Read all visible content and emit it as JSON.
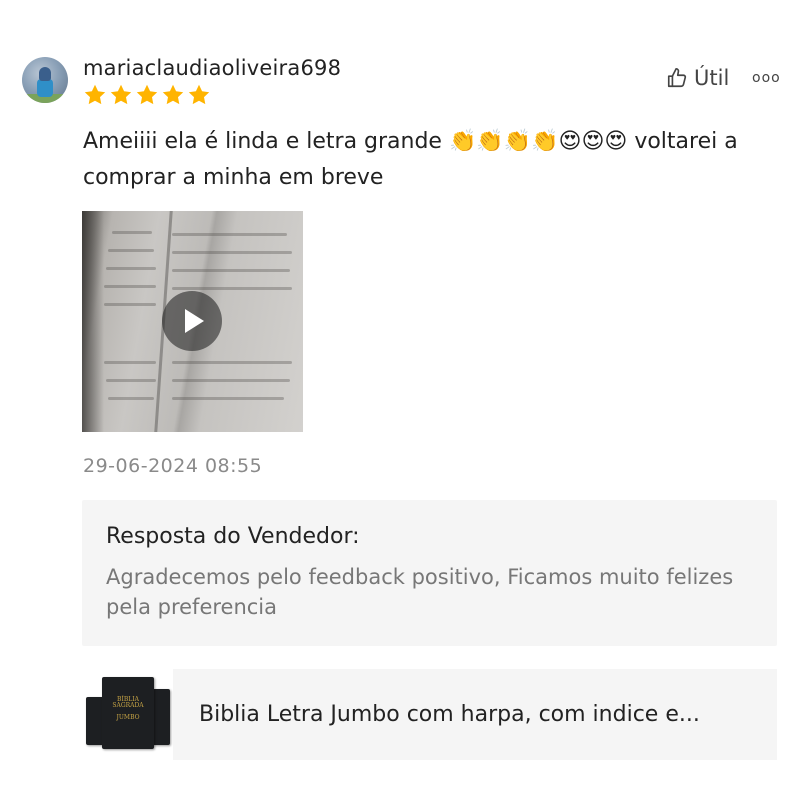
{
  "review": {
    "username": "mariaclaudiaoliveira698",
    "rating": 5,
    "helpful_label": "Útil",
    "more_label": "ooo",
    "text": "Ameiiii ela é linda e letra grande 👏👏👏👏😍😍😍 voltarei a comprar a minha em breve",
    "timestamp": "29-06-2024 08:55"
  },
  "media": {
    "type": "video",
    "icon": "play-icon"
  },
  "seller_reply": {
    "title": "Resposta do Vendedor:",
    "body": "Agradecemos pelo feedback positivo, Ficamos muito felizes pela preferencia"
  },
  "product": {
    "title": "Biblia Letra Jumbo com harpa, com indice e...",
    "thumbnail_text": "Bíblia Sagrada\nJumbo"
  },
  "colors": {
    "star": "#FFB400",
    "muted_text": "#8a8a8a",
    "panel_bg": "#f5f5f5"
  }
}
